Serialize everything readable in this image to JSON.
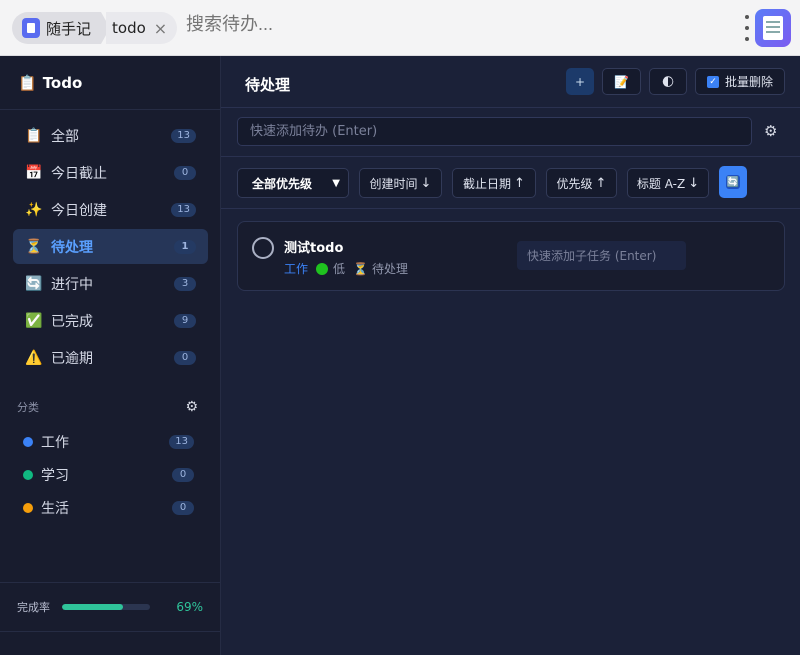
{
  "topbar": {
    "app_name": "随手记",
    "page_name": "todo",
    "close_glyph": "×",
    "search_placeholder": "搜索待办..."
  },
  "sidebar": {
    "title": "Todo",
    "title_icon": "📋",
    "nav": [
      {
        "icon": "📋",
        "label": "全部",
        "count": "13",
        "active": false
      },
      {
        "icon": "📅",
        "label": "今日截止",
        "count": "0",
        "active": false
      },
      {
        "icon": "✨",
        "label": "今日创建",
        "count": "13",
        "active": false
      },
      {
        "icon": "⏳",
        "label": "待处理",
        "count": "1",
        "active": true
      },
      {
        "icon": "🔄",
        "label": "进行中",
        "count": "3",
        "active": false
      },
      {
        "icon": "✅",
        "label": "已完成",
        "count": "9",
        "active": false
      },
      {
        "icon": "⚠️",
        "label": "已逾期",
        "count": "0",
        "active": false
      }
    ],
    "categories_title": "分类",
    "categories": [
      {
        "label": "工作",
        "count": "13",
        "color": "#3b82f6"
      },
      {
        "label": "学习",
        "count": "0",
        "color": "#10b981"
      },
      {
        "label": "生活",
        "count": "0",
        "color": "#f59e0b"
      }
    ],
    "footer": {
      "label": "完成率",
      "percent_text": "69%",
      "percent_value": 69
    }
  },
  "main": {
    "title": "待处理",
    "add_button": "+",
    "note_icon": "📝",
    "theme_icon": "🌓",
    "batch_delete": "批量删除",
    "quick_add_placeholder": "快速添加待办 (Enter)",
    "filters": {
      "priority_select": "全部优先级",
      "sort_created": "创建时间",
      "sort_created_arrow": "↓",
      "sort_due": "截止日期",
      "sort_due_arrow": "↑",
      "sort_priority": "优先级",
      "sort_priority_arrow": "↑",
      "sort_title": "标题 A-Z",
      "sort_title_arrow": "↓",
      "refresh_icon": "🔄"
    },
    "todos": [
      {
        "title": "测试todo",
        "category": "工作",
        "priority": "低",
        "status_icon": "⏳",
        "status": "待处理",
        "subtask_placeholder": "快速添加子任务 (Enter)"
      }
    ]
  },
  "colors": {
    "accent": "#3b82f6",
    "progress": "#2fc49a",
    "priority_low": "#1fc21f"
  }
}
